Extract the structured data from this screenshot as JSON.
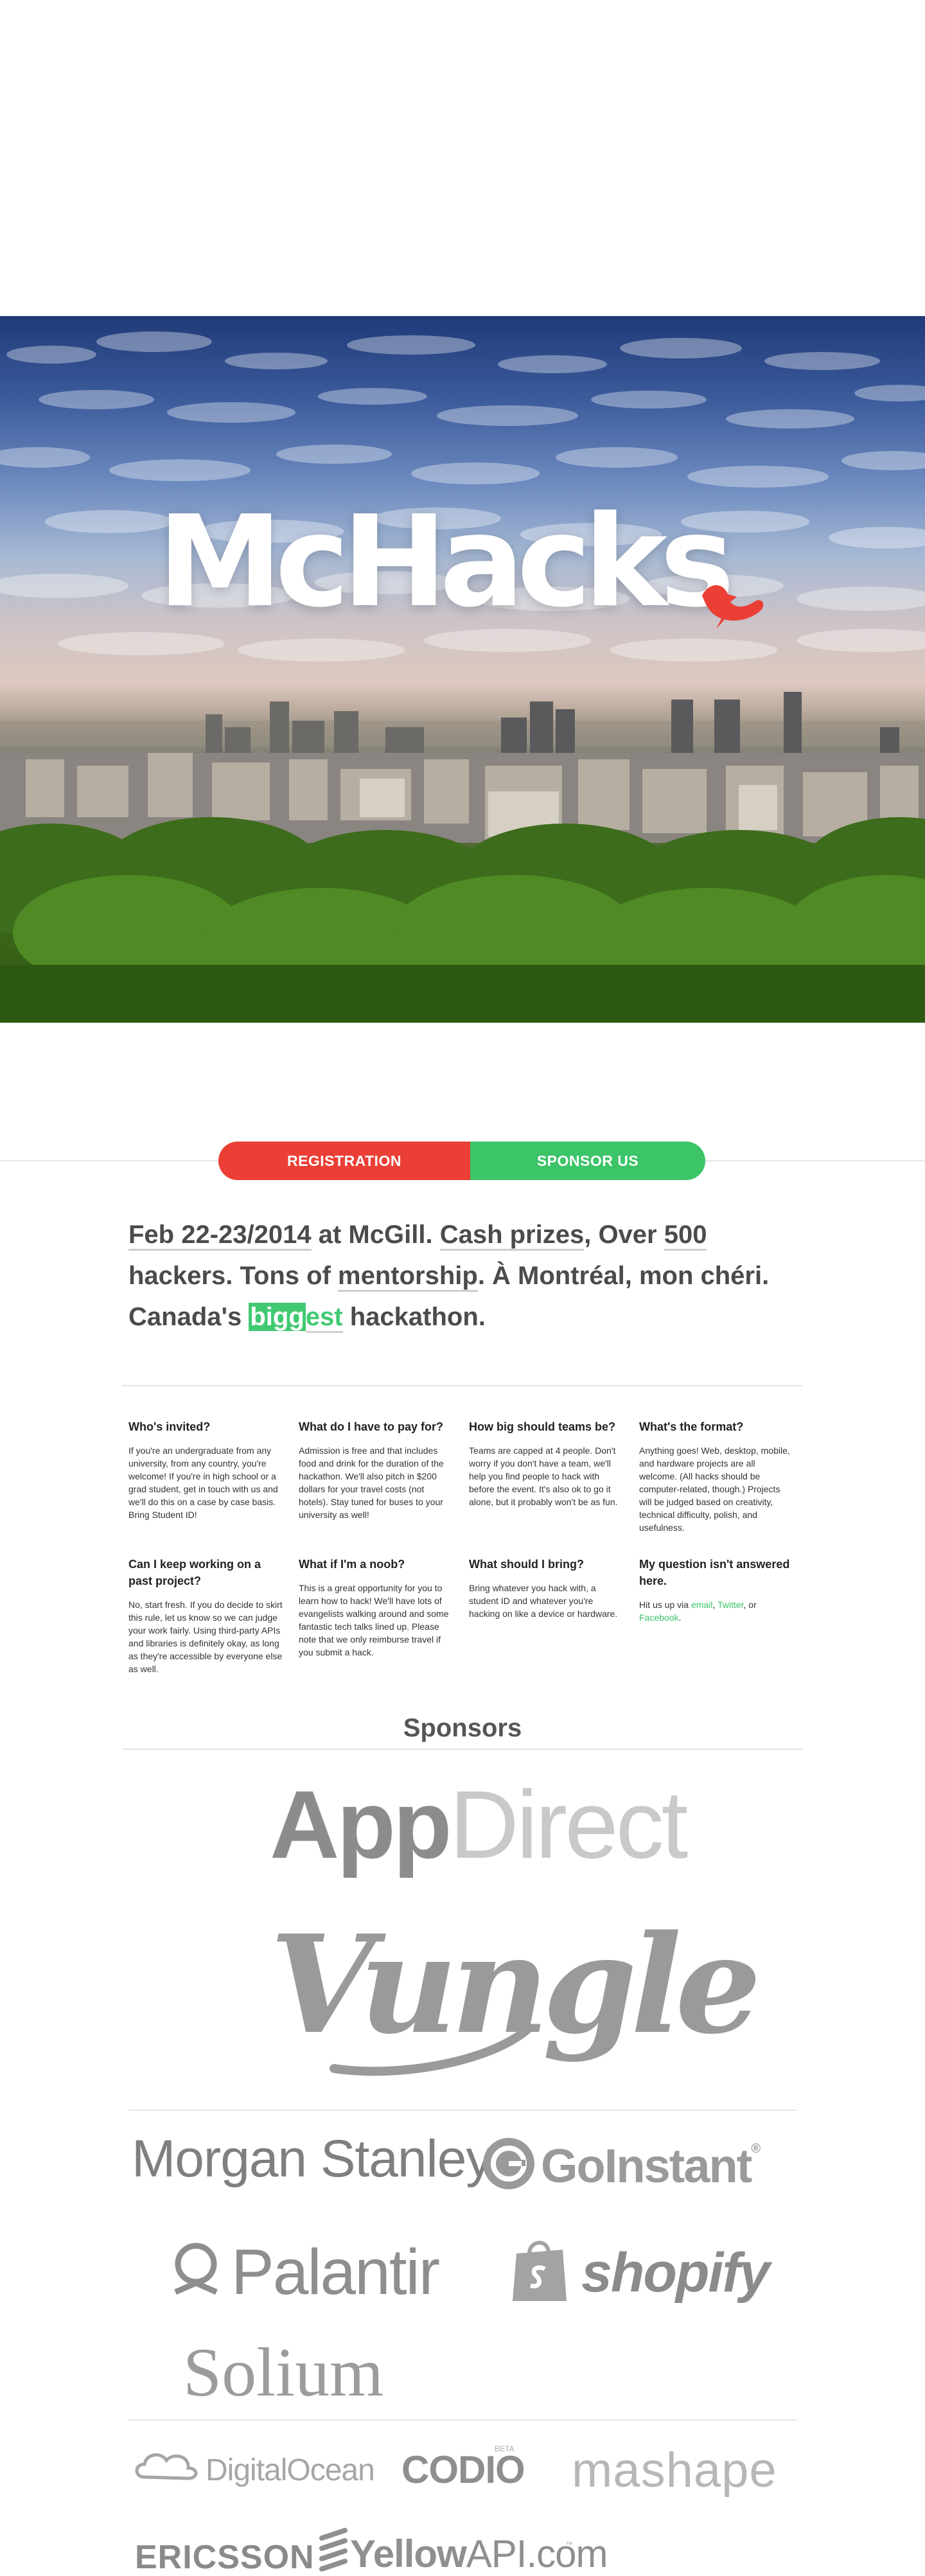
{
  "hero": {
    "logo_text": "McHacks",
    "logo_bird_color": "#eb3f36"
  },
  "nav": {
    "registration_label": "REGISTRATION",
    "sponsor_label": "SPONSOR US",
    "registration_color": "#eb3f36",
    "sponsor_color": "#3cc468"
  },
  "intro": {
    "date": "Feb 22-23/2014",
    "t1": " at McGill. ",
    "prizes": "Cash prizes",
    "t2": ", Over ",
    "count": "500",
    "t3": " hackers. Tons of ",
    "mentorship": "mentorship",
    "t4": ". À Montréal, mon chéri. Canada's ",
    "big": "bigg",
    "est": "est",
    "t5": " hackathon."
  },
  "faq": {
    "items": [
      {
        "q": "Who's invited?",
        "a": "If you're an undergraduate from any university, from any country, you're welcome! If you're in high school or a grad student, get in touch with us and we'll do this on a case by case basis. Bring Student ID!"
      },
      {
        "q": "What do I have to pay for?",
        "a": "Admission is free and that includes food and drink for the duration of the hackathon. We'll also pitch in $200 dollars for your travel costs (not hotels). Stay tuned for buses to your university as well!"
      },
      {
        "q": "How big should teams be?",
        "a": "Teams are capped at 4 people. Don't worry if you don't have a team, we'll help you find people to hack with before the event. It's also ok to go it alone, but it probably won't be as fun."
      },
      {
        "q": "What's the format?",
        "a": "Anything goes! Web, desktop, mobile, and hardware projects are all welcome. (All hacks should be computer-related, though.) Projects will be judged based on creativity, technical difficulty, polish, and usefulness."
      },
      {
        "q": "Can I keep working on a past project?",
        "a": "No, start fresh. If you do decide to skirt this rule, let us know so we can judge your work fairly. Using third-party APIs and libraries is definitely okay, as long as they're accessible by everyone else as well."
      },
      {
        "q": "What if I'm a noob?",
        "a": "This is a great opportunity for you to learn how to hack! We'll have lots of evangelists walking around and some fantastic tech talks lined up. Please note that we only reimburse travel if you submit a hack."
      },
      {
        "q": "What should I bring?",
        "a": "Bring whatever you hack with, a student ID and whatever you're hacking on like a device or hardware."
      },
      {
        "q": "My question isn't answered here.",
        "a_prefix": "Hit us up via ",
        "link_email": "email",
        "sep1": ", ",
        "link_twitter": "Twitter",
        "sep2": ", or ",
        "link_facebook": "Facebook",
        "a_suffix": "."
      }
    ]
  },
  "sponsors": {
    "title": "Sponsors",
    "appdirect_a": "App",
    "appdirect_b": "Direct",
    "vungle": "Vungle",
    "morgan_stanley": "Morgan Stanley",
    "goinstant": "GoInstant",
    "goinstant_reg": "®",
    "palantir": "Palantir",
    "shopify": "shopify",
    "solium": "Solium",
    "digitalocean": "DigitalOcean",
    "codio": "CODIO",
    "codio_beta": "BETA",
    "mashape": "mashape",
    "ericsson": "ERICSSON",
    "yellowapi_a": "Yellow",
    "yellowapi_b": "API.com",
    "yellowapi_tm": "™"
  }
}
